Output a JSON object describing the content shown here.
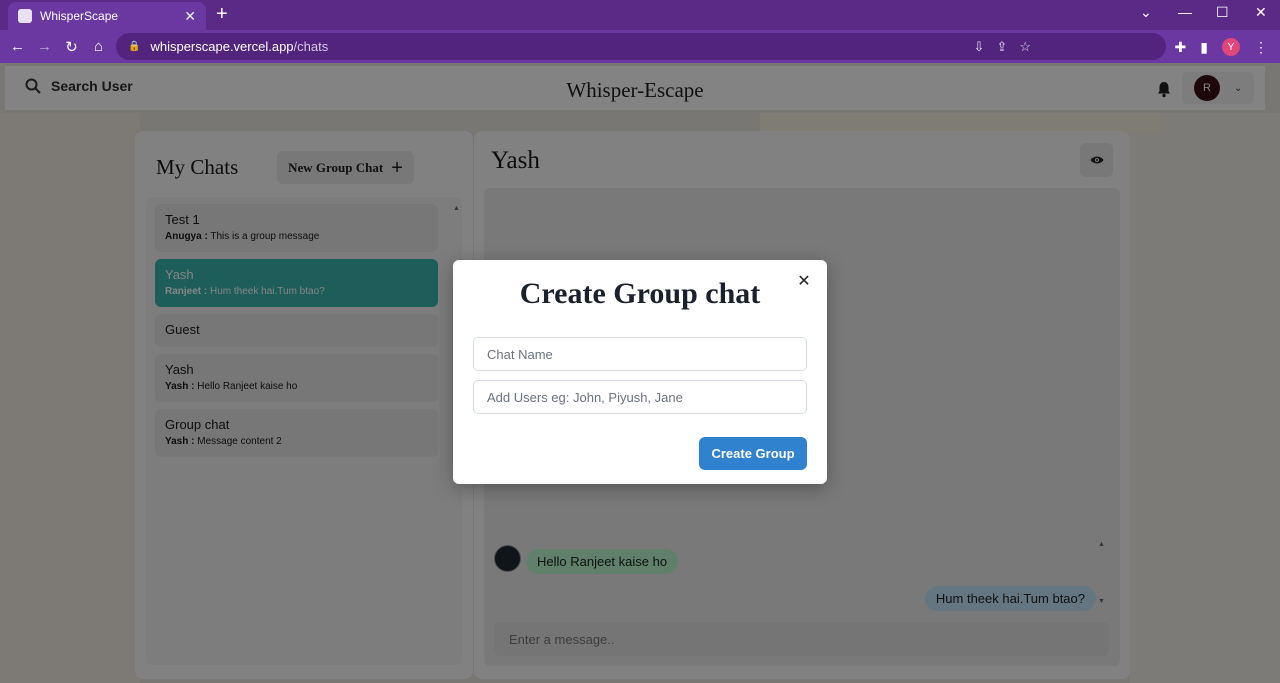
{
  "browser": {
    "tab_title": "WhisperScape",
    "url_domain": "whisperscape.vercel.app",
    "url_path": "/chats",
    "profile_initial": "Y"
  },
  "header": {
    "search_label": "Search User",
    "app_title": "Whisper-Escape",
    "user_initial": "R"
  },
  "sidebar": {
    "title": "My Chats",
    "new_group_label": "New Group Chat",
    "chats": [
      {
        "name": "Test 1",
        "sender": "Anugya :",
        "message": "This is a group message"
      },
      {
        "name": "Yash",
        "sender": "Ranjeet :",
        "message": "Hum theek hai.Tum btao?"
      },
      {
        "name": "Guest",
        "sender": "",
        "message": ""
      },
      {
        "name": "Yash",
        "sender": "Yash :",
        "message": "Hello Ranjeet kaise ho"
      },
      {
        "name": "Group chat",
        "sender": "Yash :",
        "message": "Message content 2"
      }
    ]
  },
  "chat": {
    "title": "Yash",
    "messages": [
      {
        "text": "Hello Ranjeet kaise ho",
        "direction": "incoming"
      },
      {
        "text": "Hum theek hai.Tum btao?",
        "direction": "outgoing"
      }
    ],
    "input_placeholder": "Enter a message.."
  },
  "modal": {
    "title": "Create Group chat",
    "chat_name_placeholder": "Chat Name",
    "add_users_placeholder": "Add Users eg: John, Piyush, Jane",
    "create_label": "Create Group"
  },
  "colors": {
    "active_chat": "#38b2ac",
    "primary_button": "#3182ce",
    "incoming_bubble": "#b9f5d0",
    "outgoing_bubble": "#bee3f8",
    "browser_chrome": "#6b37a0"
  }
}
